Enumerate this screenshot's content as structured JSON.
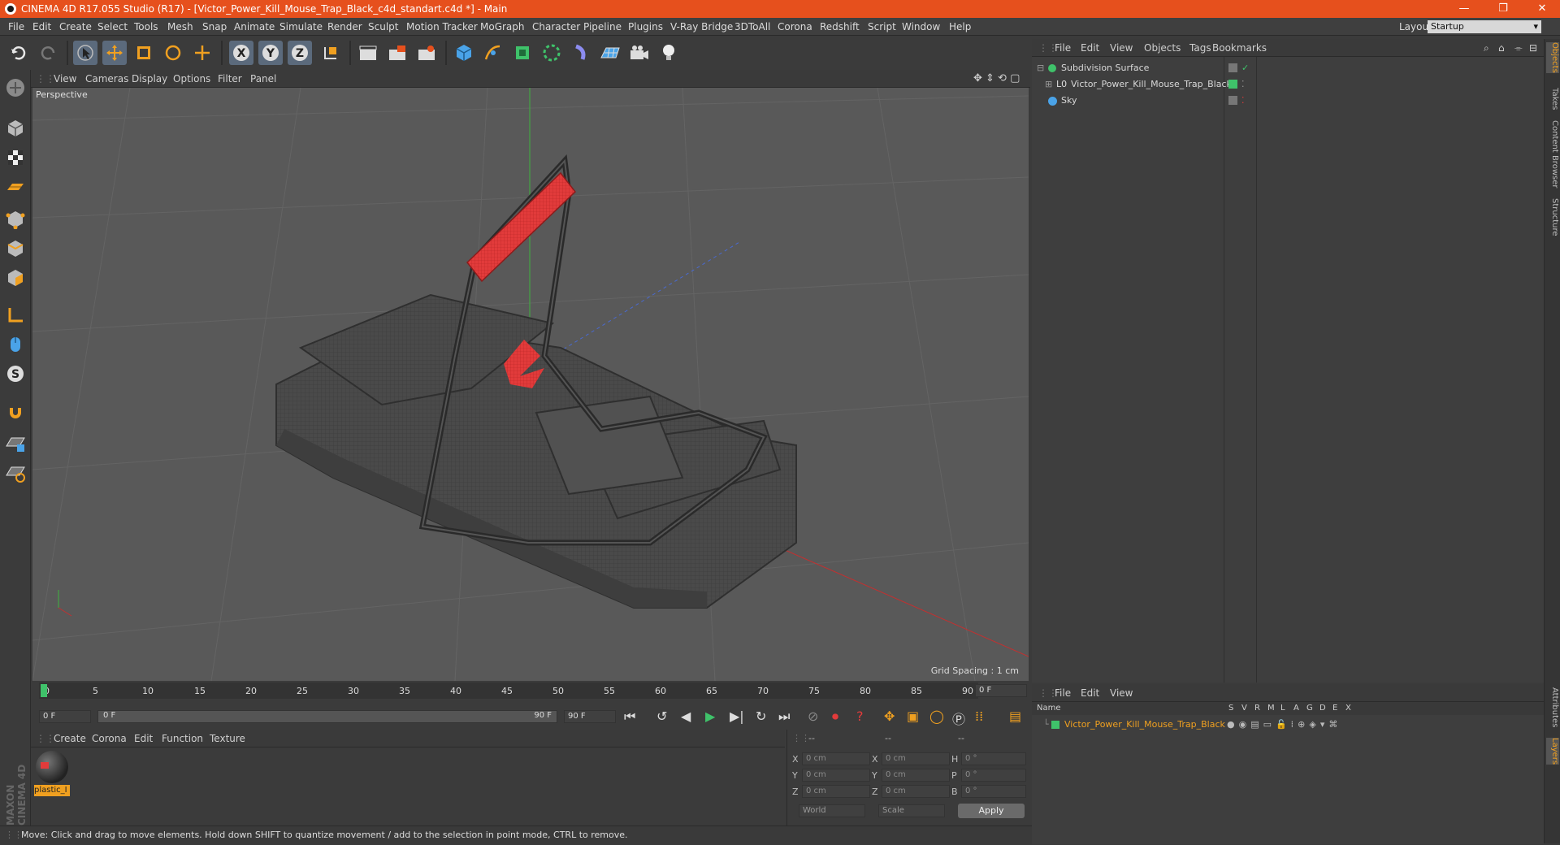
{
  "window": {
    "title": "CINEMA 4D R17.055 Studio (R17) - [Victor_Power_Kill_Mouse_Trap_Black_c4d_standart.c4d *] - Main",
    "minimize": "—",
    "maximize": "❐",
    "close": "✕"
  },
  "menu": {
    "items": [
      "File",
      "Edit",
      "Create",
      "Select",
      "Tools",
      "Mesh",
      "Snap",
      "Animate",
      "Simulate",
      "Render",
      "Sculpt",
      "Motion Tracker",
      "MoGraph",
      "Character",
      "Pipeline",
      "Plugins",
      "V-Ray Bridge",
      "3DToAll",
      "Corona",
      "Redshift",
      "Script",
      "Window",
      "Help"
    ],
    "layout_label": "Layout:",
    "layout_value": "Startup"
  },
  "viewport": {
    "menu": [
      "View",
      "Cameras",
      "Display",
      "Options",
      "Filter",
      "Panel"
    ],
    "label": "Perspective",
    "grid_spacing": "Grid Spacing : 1 cm"
  },
  "timeline": {
    "ticks": [
      "0",
      "5",
      "10",
      "15",
      "20",
      "25",
      "30",
      "35",
      "40",
      "45",
      "50",
      "55",
      "60",
      "65",
      "70",
      "75",
      "80",
      "85",
      "90"
    ],
    "current_frame_right": "0 F",
    "start_field": "0 F",
    "slider_start": "0 F",
    "slider_end": "90 F",
    "end_field": "90 F"
  },
  "materials": {
    "menu": [
      "Create",
      "Corona",
      "Edit",
      "Function",
      "Texture"
    ],
    "items": [
      {
        "name": "plastic_I"
      }
    ]
  },
  "coords": {
    "headers": [
      "--",
      "--",
      "--"
    ],
    "rows": [
      {
        "l1": "X",
        "v1": "0 cm",
        "l2": "X",
        "v2": "0 cm",
        "l3": "H",
        "v3": "0 °"
      },
      {
        "l1": "Y",
        "v1": "0 cm",
        "l2": "Y",
        "v2": "0 cm",
        "l3": "P",
        "v3": "0 °"
      },
      {
        "l1": "Z",
        "v1": "0 cm",
        "l2": "Z",
        "v2": "0 cm",
        "l3": "B",
        "v3": "0 °"
      }
    ],
    "world": "World",
    "scale": "Scale",
    "apply": "Apply"
  },
  "objects": {
    "menu": [
      "File",
      "Edit",
      "View",
      "Objects",
      "Tags",
      "Bookmarks"
    ],
    "items": [
      {
        "name": "Subdivision Surface"
      },
      {
        "name": "Victor_Power_Kill_Mouse_Trap_Black"
      },
      {
        "name": "Sky"
      }
    ]
  },
  "layers": {
    "menu": [
      "File",
      "Edit",
      "View"
    ],
    "col_name": "Name",
    "cols": [
      "S",
      "V",
      "R",
      "M",
      "L",
      "A",
      "G",
      "D",
      "E",
      "X"
    ],
    "items": [
      {
        "name": "Victor_Power_Kill_Mouse_Trap_Black"
      }
    ]
  },
  "side_tabs": [
    "Objects",
    "Takes",
    "Content Browser",
    "Structure"
  ],
  "side_tabs_bottom": [
    "Attributes",
    "Layers"
  ],
  "brand": "MAXON CINEMA 4D",
  "status": "Move: Click and drag to move elements. Hold down SHIFT to quantize movement / add to the selection in point mode, CTRL to remove.",
  "colors": {
    "title_bar": "#e6501d",
    "accent_orange": "#f0a020",
    "object_green": "#3fc26a",
    "trap_red": "#e23b3b"
  }
}
